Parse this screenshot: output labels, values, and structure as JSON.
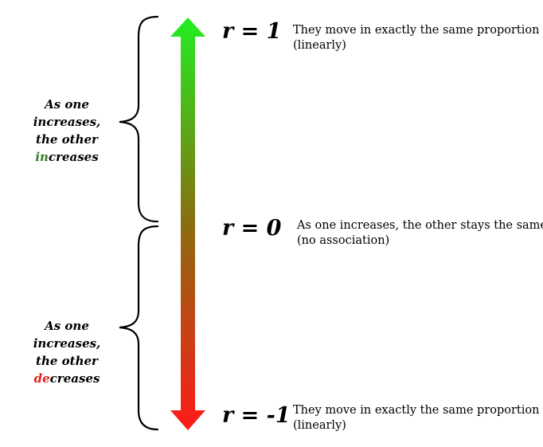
{
  "scale": [
    {
      "label": "r = 1",
      "desc_line1": "They move in exactly the same proportion",
      "desc_line2": "(linearly)"
    },
    {
      "label": "r = 0",
      "desc_line1": "As one increases, the other stays the same",
      "desc_line2": "(no association)"
    },
    {
      "label": "r = -1",
      "desc_line1": "They move in exactly the same proportion",
      "desc_line2": "(linearly)"
    }
  ],
  "upper_brace": {
    "line1": "As one",
    "line2": "increases,",
    "line3": "the other",
    "line4_highlight": "in",
    "line4_rest": "creases"
  },
  "lower_brace": {
    "line1": "As one",
    "line2": "increases,",
    "line3": "the other",
    "line4_highlight": "de",
    "line4_rest": "creases"
  },
  "colors": {
    "top": "#22ee22",
    "middle": "#8a6d10",
    "bottom": "#ff1a1a",
    "increase_highlight": "#3c7a2b",
    "decrease_highlight": "#e81c1c"
  },
  "icons": [
    "double-headed-arrow",
    "curly-brace-upper",
    "curly-brace-lower"
  ]
}
